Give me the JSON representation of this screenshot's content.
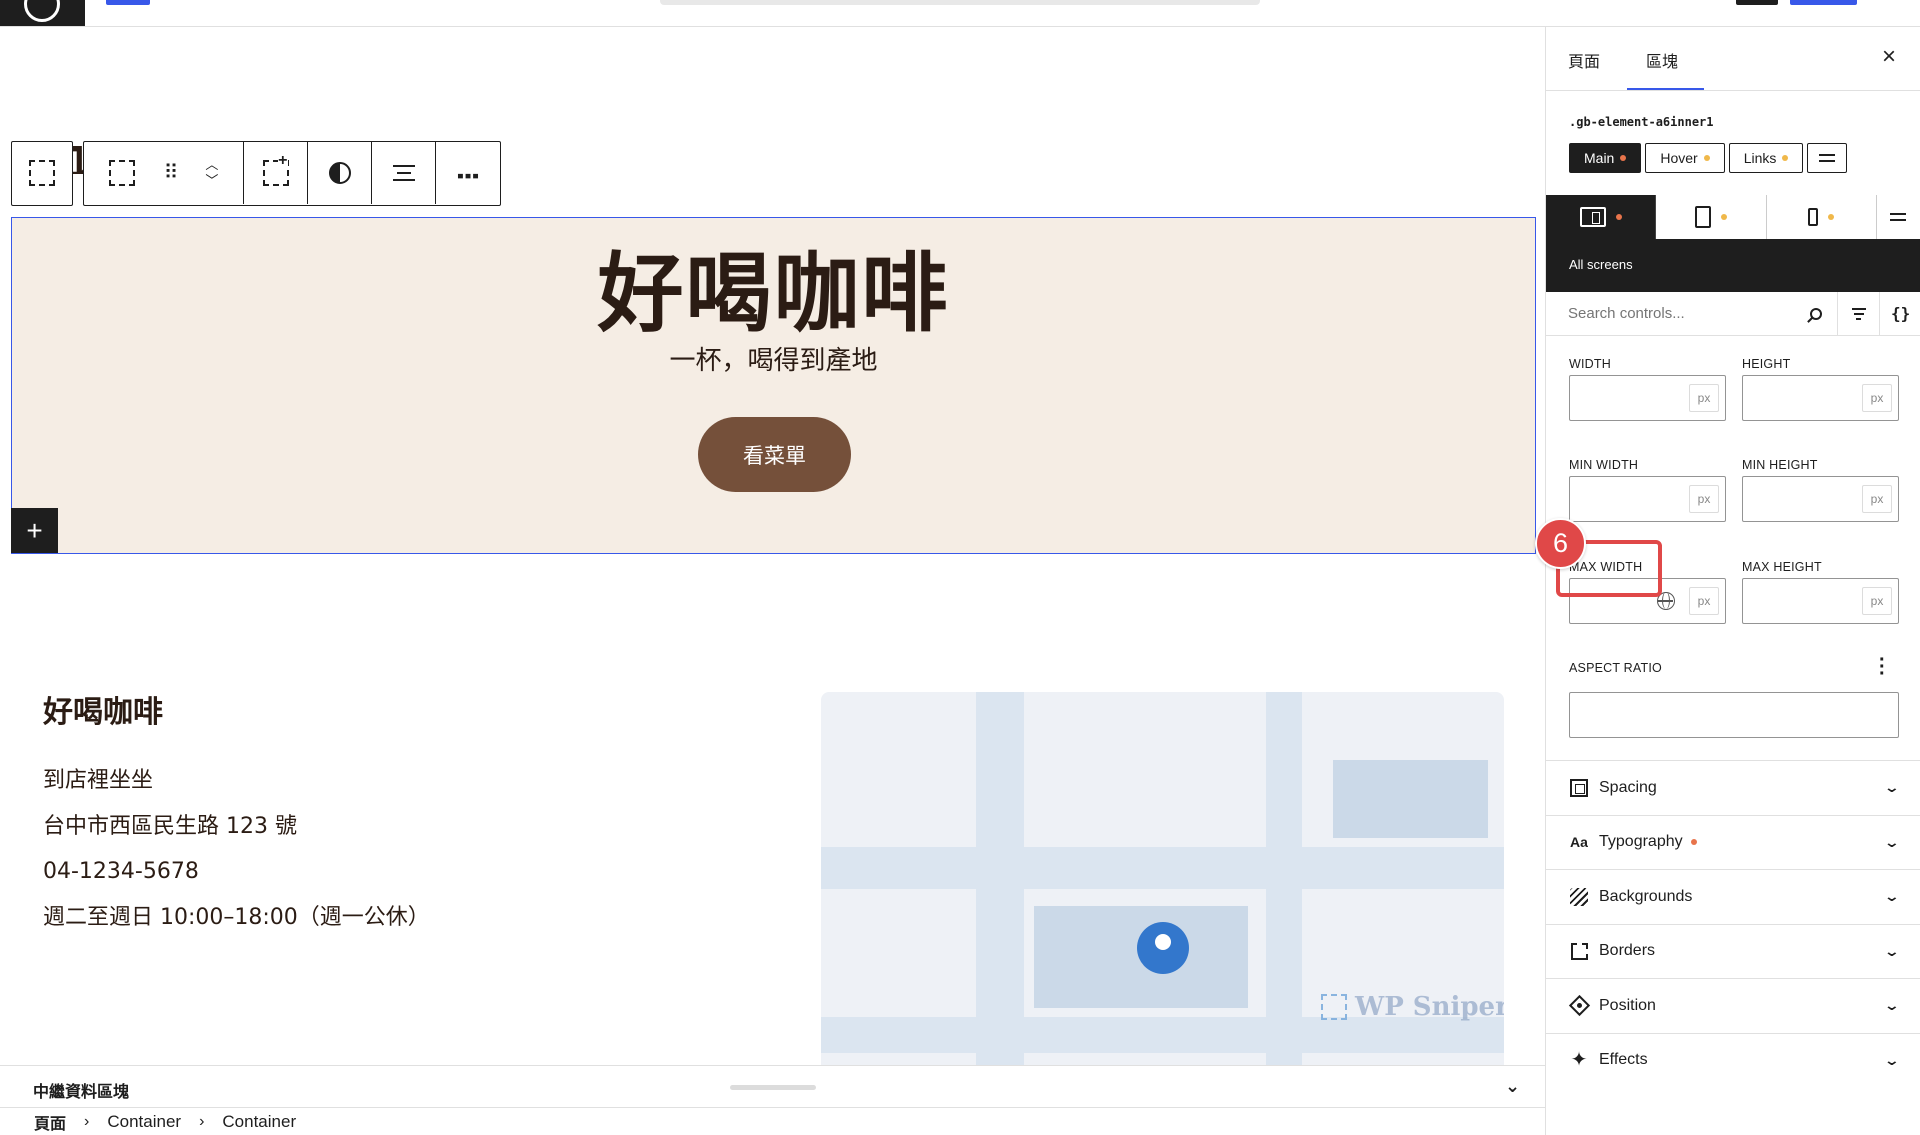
{
  "canvas": {
    "background_title": "好喝咖啡",
    "hero": {
      "title": "好喝咖啡",
      "subtitle": "一杯，喝得到產地",
      "button_label": "看菜單",
      "add_label": "+"
    },
    "info": {
      "title": "好喝咖啡",
      "lines": [
        "到店裡坐坐",
        "台中市西區民生路 123 號",
        "04-1234-5678",
        "週二至週日 10:00–18:00（週一公休）"
      ]
    },
    "map_watermark": "WP Sniper"
  },
  "colors": {
    "hero_bg": "#f5ede4",
    "brand_brown": "#75503a",
    "title_color": "#2b1c14",
    "accent_blue": "#3858e9",
    "highlight_red": "#e04848",
    "map_pin": "#3377cc"
  },
  "bottom": {
    "meta_label": "中繼資料區塊",
    "breadcrumb": [
      "頁面",
      "Container",
      "Container"
    ]
  },
  "sidebar": {
    "tabs": [
      "頁面",
      "區塊"
    ],
    "active_tab": "區塊",
    "close_icon": "×",
    "selector": ".gb-element-a6inner1",
    "states": [
      {
        "label": "Main",
        "active": true
      },
      {
        "label": "Hover",
        "active": false
      },
      {
        "label": "Links",
        "active": false
      }
    ],
    "device_label": "All screens",
    "search_placeholder": "Search controls...",
    "braces_label": "{}",
    "fields": {
      "width": "WIDTH",
      "height": "HEIGHT",
      "min_width": "MIN WIDTH",
      "min_height": "MIN HEIGHT",
      "max_width": "MAX WIDTH",
      "max_height": "MAX HEIGHT",
      "aspect_ratio": "ASPECT RATIO",
      "unit": "px"
    },
    "step_badge": "6",
    "sections": [
      {
        "label": "Spacing",
        "icon": "spacing-icon"
      },
      {
        "label": "Typography",
        "icon": "typography-icon"
      },
      {
        "label": "Backgrounds",
        "icon": "backgrounds-icon"
      },
      {
        "label": "Borders",
        "icon": "borders-icon"
      },
      {
        "label": "Position",
        "icon": "position-icon"
      },
      {
        "label": "Effects",
        "icon": "effects-icon"
      }
    ],
    "typography_icon_text": "Aa"
  }
}
